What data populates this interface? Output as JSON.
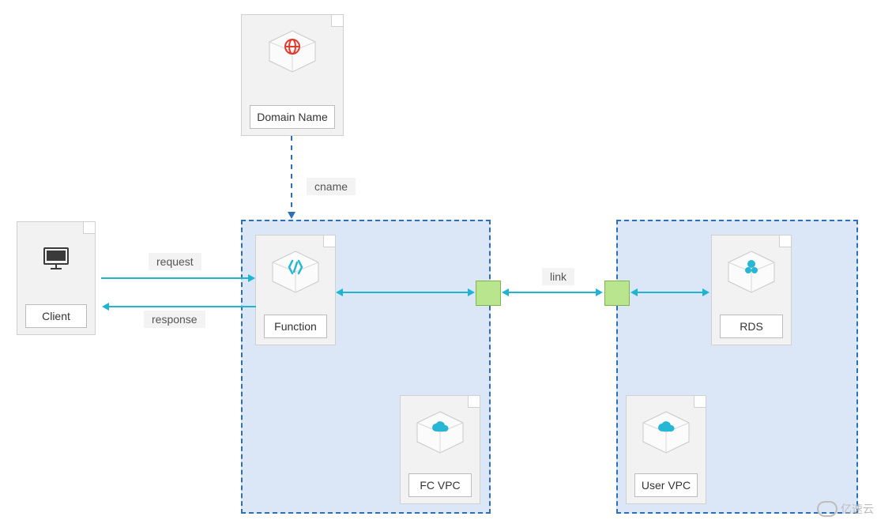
{
  "nodes": {
    "domain": {
      "label": "Domain Name"
    },
    "client": {
      "label": "Client"
    },
    "function": {
      "label": "Function"
    },
    "fc_vpc": {
      "label": "FC VPC"
    },
    "rds": {
      "label": "RDS"
    },
    "user_vpc": {
      "label": "User VPC"
    }
  },
  "edges": {
    "cname": "cname",
    "request": "request",
    "response": "response",
    "link": "link"
  },
  "watermark": "亿速云",
  "colors": {
    "vpc_bg": "#dbe6f6",
    "vpc_border": "#2e6fb5",
    "gateway": "#b9e58e",
    "arrow": "#1fb4d2"
  }
}
